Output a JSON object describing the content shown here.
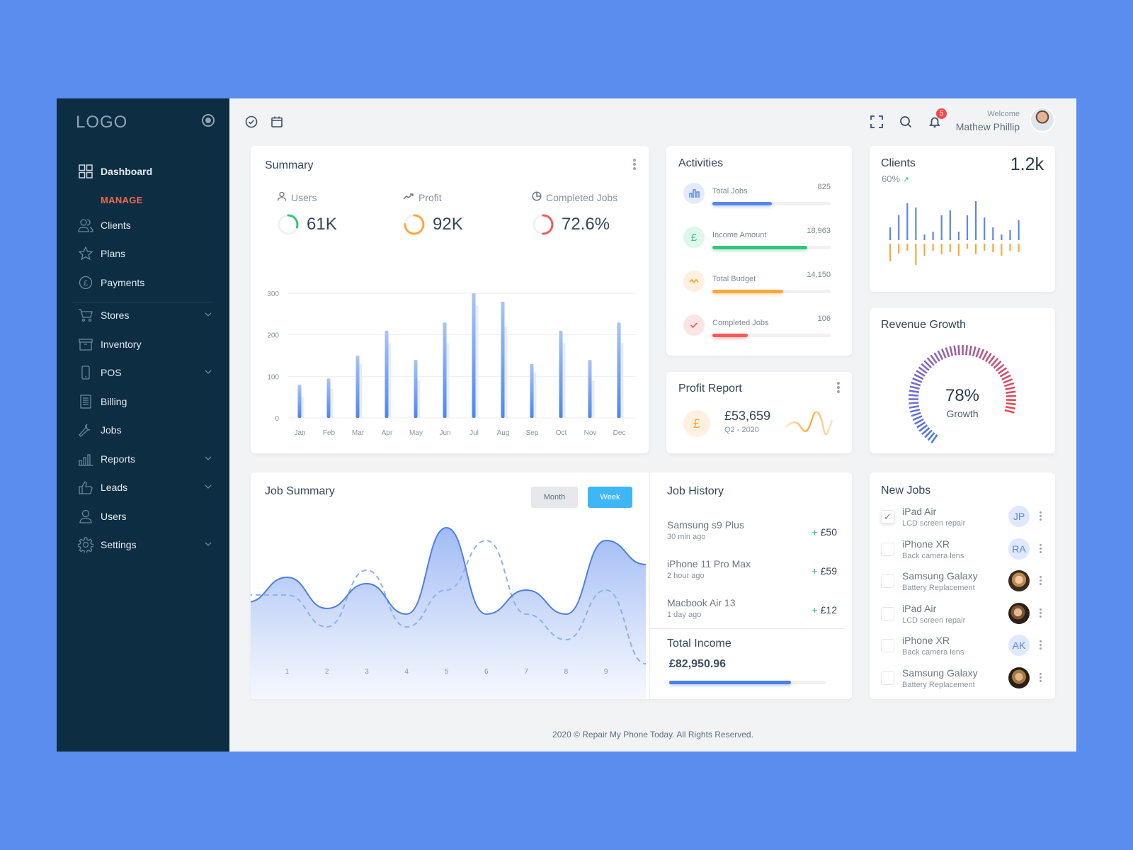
{
  "sidebar": {
    "logo": "LOGO",
    "section_label": "MANAGE",
    "items": [
      {
        "label": "Dashboard",
        "icon": "grid-icon"
      },
      {
        "label": "Clients",
        "icon": "users-icon"
      },
      {
        "label": "Plans",
        "icon": "star-icon"
      },
      {
        "label": "Payments",
        "icon": "pound-circle-icon"
      },
      {
        "label": "Stores",
        "icon": "cart-icon",
        "expandable": true
      },
      {
        "label": "Inventory",
        "icon": "archive-icon"
      },
      {
        "label": "POS",
        "icon": "phone-icon",
        "expandable": true
      },
      {
        "label": "Billing",
        "icon": "document-icon"
      },
      {
        "label": "Jobs",
        "icon": "wrench-icon"
      },
      {
        "label": "Reports",
        "icon": "bar-chart-icon",
        "expandable": true
      },
      {
        "label": "Leads",
        "icon": "thumbs-up-icon",
        "expandable": true
      },
      {
        "label": "Users",
        "icon": "user-icon"
      },
      {
        "label": "Settings",
        "icon": "gear-icon",
        "expandable": true
      }
    ]
  },
  "header": {
    "welcome": "Welcome",
    "user_name": "Mathew Phillip",
    "notification_count": "5"
  },
  "summary": {
    "title": "Summary",
    "stats": [
      {
        "label": "Users",
        "value": "61K",
        "ring_fraction": 0.3,
        "color": "#35c47c"
      },
      {
        "label": "Profit",
        "value": "92K",
        "ring_fraction": 0.75,
        "color": "#fca83a"
      },
      {
        "label": "Completed Jobs",
        "value": "72.6%",
        "ring_fraction": 0.5,
        "color": "#f55a5a"
      }
    ]
  },
  "chart_data": [
    {
      "type": "bar",
      "categories": [
        "Jan",
        "Feb",
        "Mar",
        "Apr",
        "May",
        "Jun",
        "Jul",
        "Aug",
        "Sep",
        "Oct",
        "Nov",
        "Dec"
      ],
      "series": [
        {
          "values": [
            80,
            95,
            150,
            210,
            140,
            230,
            300,
            280,
            130,
            210,
            140,
            230
          ],
          "color": "#4e86ee"
        },
        {
          "values": [
            50,
            70,
            130,
            180,
            90,
            180,
            270,
            220,
            110,
            180,
            90,
            180
          ],
          "color": "#e6eefc"
        }
      ],
      "yticks": [
        0,
        100,
        200,
        300
      ],
      "ylim": [
        0,
        300
      ],
      "grid": true
    },
    {
      "type": "area",
      "x_ticks": [
        1,
        2,
        3,
        4,
        5,
        6,
        7,
        8,
        9
      ],
      "series": [
        {
          "style": "solid",
          "x": [
            0,
            1,
            2,
            3,
            4,
            5,
            6,
            7,
            8,
            9,
            10
          ],
          "values": [
            117,
            152,
            108,
            143,
            100,
            222,
            100,
            134,
            100,
            204,
            170
          ]
        },
        {
          "style": "dashed",
          "x": [
            0,
            1,
            2,
            3,
            4,
            5,
            6,
            7,
            8,
            9,
            10
          ],
          "values": [
            127,
            127,
            82,
            162,
            82,
            134,
            204,
            100,
            64,
            134,
            30
          ]
        }
      ]
    },
    {
      "type": "bar",
      "series": [
        {
          "values": [
            18,
            35,
            52,
            46,
            8,
            12,
            35,
            42,
            12,
            35,
            55,
            32,
            18,
            8,
            14,
            28
          ],
          "color": "#5b87e8"
        },
        {
          "values": [
            25,
            14,
            10,
            30,
            17,
            10,
            15,
            12,
            17,
            7,
            15,
            10,
            12,
            17,
            10,
            12
          ],
          "color": "#fca83a"
        }
      ]
    }
  ],
  "activities": {
    "title": "Activities",
    "items": [
      {
        "label": "Total Jobs",
        "value": "825",
        "progress": 0.5,
        "color": "#5b87e8",
        "bg": "#e3ebfc",
        "icon": "bar-chart-icon"
      },
      {
        "label": "Income Amount",
        "value": "18,963",
        "progress": 0.8,
        "color": "#35c47c",
        "bg": "#dff6ea",
        "icon": "pound-icon"
      },
      {
        "label": "Total Budget",
        "value": "14,150",
        "progress": 0.6,
        "color": "#fca83a",
        "bg": "#fff0df",
        "icon": "pulse-icon"
      },
      {
        "label": "Completed Jobs",
        "value": "106",
        "progress": 0.3,
        "color": "#f55a5a",
        "bg": "#fde5e5",
        "icon": "check-icon"
      }
    ]
  },
  "clients": {
    "title": "Clients",
    "value": "1.2k",
    "change": "60%"
  },
  "profit_report": {
    "title": "Profit Report",
    "amount": "£53,659",
    "period": "Q2 - 2020",
    "currency_symbol": "£"
  },
  "revenue_growth": {
    "title": "Revenue Growth",
    "value": "78%",
    "label": "Growth",
    "fraction": 0.78
  },
  "job_summary": {
    "title": "Job Summary",
    "month_label": "Month",
    "week_label": "Week",
    "active": "Week"
  },
  "job_history": {
    "title": "Job History",
    "items": [
      {
        "name": "Samsung s9 Plus",
        "time": "30 min ago",
        "amount": "£50"
      },
      {
        "name": "iPhone 11 Pro Max",
        "time": "2 hour ago",
        "amount": "£59"
      },
      {
        "name": "Macbook Air 13",
        "time": "1 day ago",
        "amount": "£12"
      }
    ],
    "plus": "+",
    "total_label": "Total Income",
    "total_value": "£82,950.96",
    "total_progress": 0.78
  },
  "new_jobs": {
    "title": "New Jobs",
    "items": [
      {
        "name": "iPad Air",
        "sub": "LCD screen repair",
        "initials": "JP",
        "checked": true
      },
      {
        "name": "iPhone XR",
        "sub": "Back camera lens",
        "initials": "RA",
        "checked": false
      },
      {
        "name": "Samsung Galaxy",
        "sub": "Battery Replacement",
        "initials": "",
        "checked": false
      },
      {
        "name": "iPad Air",
        "sub": "LCD screen repair",
        "initials": "",
        "checked": false
      },
      {
        "name": "iPhone XR",
        "sub": "Back camera lens",
        "initials": "AK",
        "checked": false
      },
      {
        "name": "Samsung Galaxy",
        "sub": "Battery Replacement",
        "initials": "",
        "checked": false
      }
    ]
  },
  "footer": {
    "text": "2020 © Repair My Phone Today. All Rights Reserved."
  }
}
